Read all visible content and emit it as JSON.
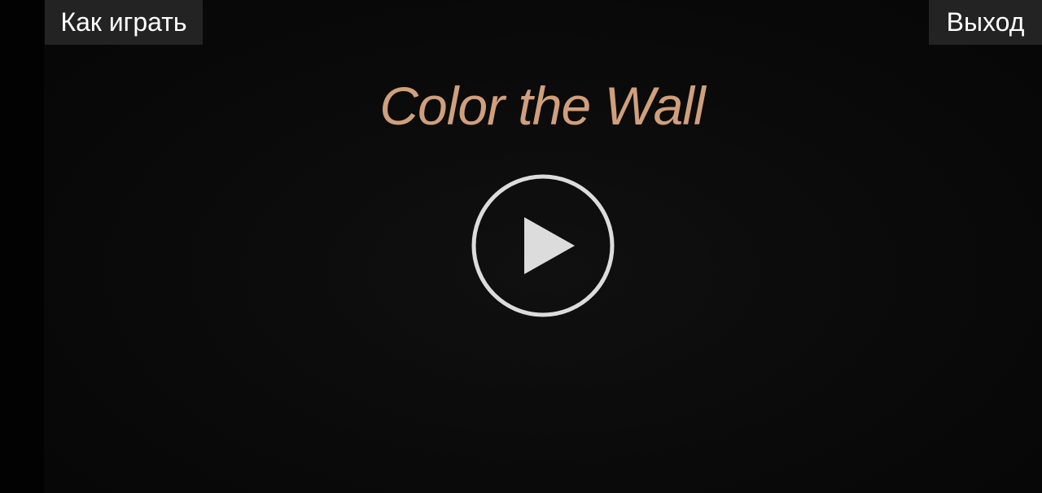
{
  "header": {
    "how_to_play_label": "Как играть",
    "exit_label": "Выход"
  },
  "title": "Color the Wall",
  "colors": {
    "background": "#020202",
    "button_bg": "#232323",
    "title": "#d09f7c",
    "play_icon": "#dcdcdc"
  },
  "icons": {
    "play": "play-icon"
  }
}
